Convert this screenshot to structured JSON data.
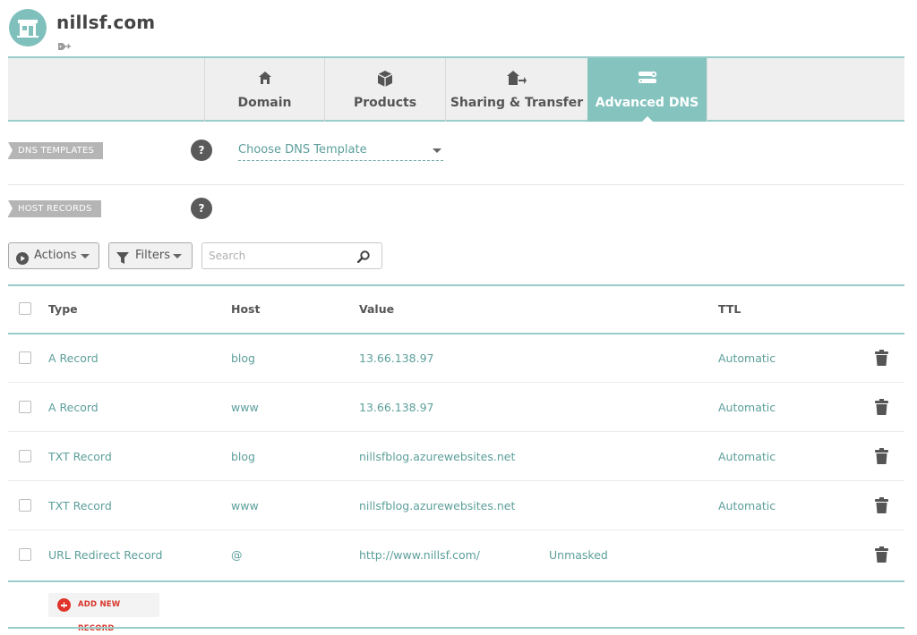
{
  "site": {
    "title": "nillsf.com",
    "avatar_icon": "storefront-icon",
    "tag_icon": "add-tag-icon"
  },
  "tabs": [
    {
      "label": "Domain",
      "icon": "home-icon",
      "active": false
    },
    {
      "label": "Products",
      "icon": "box-icon",
      "active": false
    },
    {
      "label": "Sharing & Transfer",
      "icon": "home-transfer-icon",
      "active": false
    },
    {
      "label": "Advanced DNS",
      "icon": "server-icon",
      "active": true
    }
  ],
  "dns_templates": {
    "label": "DNS TEMPLATES",
    "help": "?",
    "select_value": "Choose DNS Template"
  },
  "host_records": {
    "label": "HOST RECORDS",
    "help": "?"
  },
  "toolbar": {
    "actions_label": "Actions",
    "filters_label": "Filters",
    "search_placeholder": "Search"
  },
  "table": {
    "columns": [
      "Type",
      "Host",
      "Value",
      "TTL"
    ],
    "rows": [
      {
        "type": "A Record",
        "host": "blog",
        "value": "13.66.138.97",
        "extra": "",
        "ttl": "Automatic"
      },
      {
        "type": "A Record",
        "host": "www",
        "value": "13.66.138.97",
        "extra": "",
        "ttl": "Automatic"
      },
      {
        "type": "TXT Record",
        "host": "blog",
        "value": "nillsfblog.azurewebsites.net",
        "extra": "",
        "ttl": "Automatic"
      },
      {
        "type": "TXT Record",
        "host": "www",
        "value": "nillsfblog.azurewebsites.net",
        "extra": "",
        "ttl": "Automatic"
      },
      {
        "type": "URL Redirect Record",
        "host": "@",
        "value": "http://www.nillsf.com/",
        "extra": "Unmasked",
        "ttl": ""
      }
    ]
  },
  "add_record_label": "ADD NEW RECORD",
  "colors": {
    "accent": "#85c3bf",
    "link": "#5c9f9b",
    "danger": "#e0332a"
  }
}
